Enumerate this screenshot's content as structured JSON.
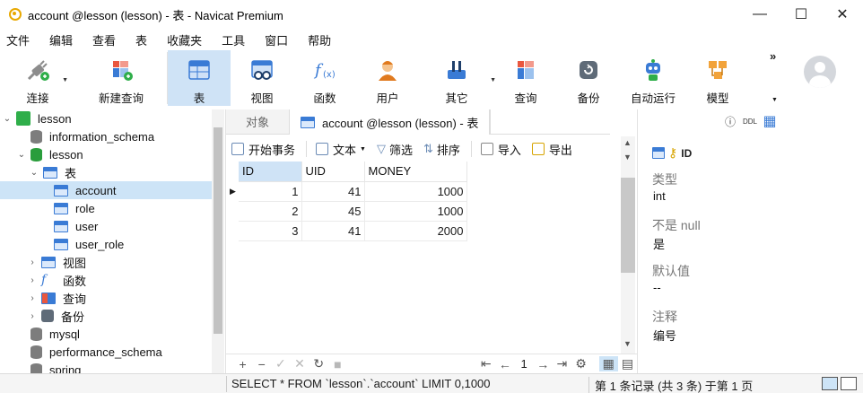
{
  "window": {
    "title": "account @lesson (lesson) - 表 - Navicat Premium",
    "minimize": "—",
    "maximize": "☐",
    "close": "✕"
  },
  "menu": [
    "文件",
    "编辑",
    "查看",
    "表",
    "收藏夹",
    "工具",
    "窗口",
    "帮助"
  ],
  "toolbar": {
    "items": [
      {
        "label": "连接",
        "icon": "plug-icon"
      },
      {
        "label": "新建查询",
        "icon": "new-query-icon"
      },
      {
        "label": "表",
        "icon": "table-icon"
      },
      {
        "label": "视图",
        "icon": "view-icon"
      },
      {
        "label": "函数",
        "icon": "function-icon"
      },
      {
        "label": "用户",
        "icon": "user-icon"
      },
      {
        "label": "其它",
        "icon": "tools-icon"
      },
      {
        "label": "查询",
        "icon": "query-icon"
      },
      {
        "label": "备份",
        "icon": "backup-icon"
      },
      {
        "label": "自动运行",
        "icon": "robot-icon"
      },
      {
        "label": "模型",
        "icon": "model-icon"
      }
    ],
    "more": "»"
  },
  "tree": {
    "connection": "lesson",
    "items": [
      {
        "label": "information_schema"
      },
      {
        "label": "lesson"
      },
      {
        "label": "表"
      },
      {
        "label": "account"
      },
      {
        "label": "role"
      },
      {
        "label": "user"
      },
      {
        "label": "user_role"
      },
      {
        "label": "视图"
      },
      {
        "label": "函数"
      },
      {
        "label": "查询"
      },
      {
        "label": "备份"
      },
      {
        "label": "mysql"
      },
      {
        "label": "performance_schema"
      },
      {
        "label": "spring"
      }
    ]
  },
  "tabs": {
    "objects": "对象",
    "active": "account @lesson (lesson) - 表"
  },
  "subtoolbar": {
    "begin_transaction": "开始事务",
    "text": "文本",
    "filter": "筛选",
    "sort": "排序",
    "import": "导入",
    "export": "导出"
  },
  "grid": {
    "columns": [
      "ID",
      "UID",
      "MONEY"
    ],
    "rows": [
      [
        "1",
        "41",
        "1000"
      ],
      [
        "2",
        "45",
        "1000"
      ],
      [
        "3",
        "41",
        "2000"
      ]
    ],
    "current_page": "1"
  },
  "info": {
    "field_name": "ID",
    "type_label": "类型",
    "type_value": "int",
    "notnull_label": "不是 null",
    "notnull_value": "是",
    "default_label": "默认值",
    "default_value": "--",
    "comment_label": "注释",
    "comment_value": "编号"
  },
  "status": {
    "query": "SELECT * FROM `lesson`.`account` LIMIT 0,1000",
    "records": "第 1 条记录 (共 3 条) 于第 1 页"
  },
  "colors": {
    "selection": "#cde4f7",
    "accent_blue": "#3a7bd5",
    "db_green": "#2a9d3c"
  }
}
